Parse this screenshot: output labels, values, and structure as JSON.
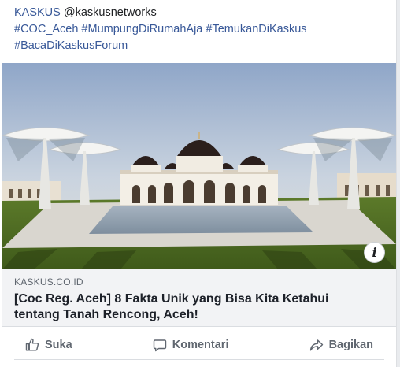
{
  "post": {
    "source_link": "KASKUS",
    "handle": "@kaskusnetworks",
    "hashtags_line1": "#COC_Aceh #MumpungDiRumahAja #TemukanDiKaskus",
    "hashtags_line2": "#BacaDiKaskusForum"
  },
  "preview": {
    "image_alt": "Masjid Raya Baiturrahman, Aceh",
    "domain": "KASKUS.CO.ID",
    "title_line1": "[Coc Reg. Aceh] 8 Fakta Unik yang Bisa Kita Ketahui",
    "title_line2": "tentang Tanah Rencong, Aceh!",
    "info_icon": "info-icon"
  },
  "actions": {
    "like": "Suka",
    "comment": "Komentari",
    "share": "Bagikan"
  },
  "colors": {
    "link": "#385898",
    "text": "#1c1e21",
    "muted": "#606770",
    "preview_bg": "#f2f3f5"
  }
}
